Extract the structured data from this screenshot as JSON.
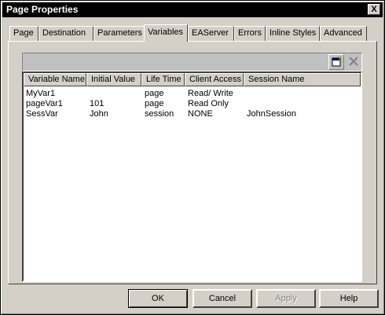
{
  "window": {
    "title": "Page Properties",
    "close_glyph": "X"
  },
  "tabs": [
    {
      "label": "Page"
    },
    {
      "label": "Destination"
    },
    {
      "label": "Parameters"
    },
    {
      "label": "Variables"
    },
    {
      "label": "EAServer"
    },
    {
      "label": "Errors"
    },
    {
      "label": "Inline Styles"
    },
    {
      "label": "Advanced"
    }
  ],
  "active_tab": "Variables",
  "toolbar": {
    "new_icon": "new-item-icon",
    "delete_icon": "delete-x-icon"
  },
  "table": {
    "columns": [
      "Variable Name",
      "Initial Value",
      "Life Time",
      "Client Access",
      "Session Name"
    ],
    "rows": [
      [
        "MyVar1",
        "",
        "page",
        "Read/ Write",
        ""
      ],
      [
        "pageVar1",
        "101",
        "page",
        "Read Only",
        ""
      ],
      [
        "SessVar",
        "John",
        "session",
        "NONE",
        "JohnSession"
      ]
    ]
  },
  "buttons": {
    "ok": "OK",
    "cancel": "Cancel",
    "apply": "Apply",
    "help": "Help"
  }
}
